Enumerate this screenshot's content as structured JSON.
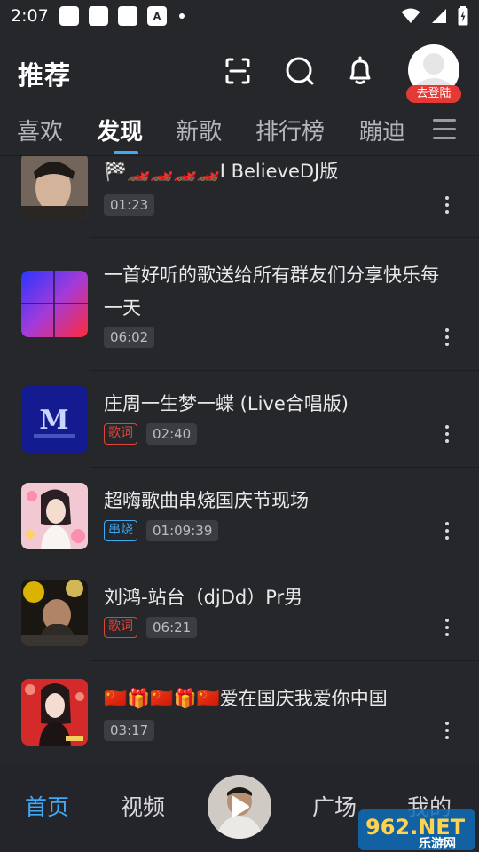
{
  "status_bar": {
    "time": "2:07",
    "notification_letter": "A"
  },
  "header": {
    "title": "推荐",
    "login_badge": "去登陆"
  },
  "tabs": [
    {
      "label": "喜欢",
      "active": false
    },
    {
      "label": "发现",
      "active": true
    },
    {
      "label": "新歌",
      "active": false
    },
    {
      "label": "排行榜",
      "active": false
    },
    {
      "label": "蹦迪",
      "active": false
    }
  ],
  "songs": [
    {
      "title": "🏁🏎️🏎️🏎️🏎️I BelieveDJ版",
      "duration": "01:23",
      "tag": ""
    },
    {
      "title": "一首好听的歌送给所有群友们分享快乐每一天",
      "duration": "06:02",
      "tag": ""
    },
    {
      "title": "庄周一生梦一蝶 (Live合唱版)",
      "duration": "02:40",
      "tag": "歌词"
    },
    {
      "title": "超嗨歌曲串烧国庆节现场",
      "duration": "01:09:39",
      "tag": "串烧"
    },
    {
      "title": "刘鸿-站台（djDd）Pr男",
      "duration": "06:21",
      "tag": "歌词"
    },
    {
      "title": "🇨🇳🎁🇨🇳🎁🇨🇳爱在国庆我爱你中国",
      "duration": "03:17",
      "tag": ""
    }
  ],
  "bottom_nav": {
    "home": "首页",
    "video": "视频",
    "square": "广场",
    "mine": "我的"
  },
  "watermark": {
    "brand": "962.NET",
    "sub": "乐游网"
  },
  "colors": {
    "background": "#26272b",
    "accent": "#3fa9f5",
    "lyrics_tag": "#e0453a",
    "login_badge": "#e53935"
  }
}
